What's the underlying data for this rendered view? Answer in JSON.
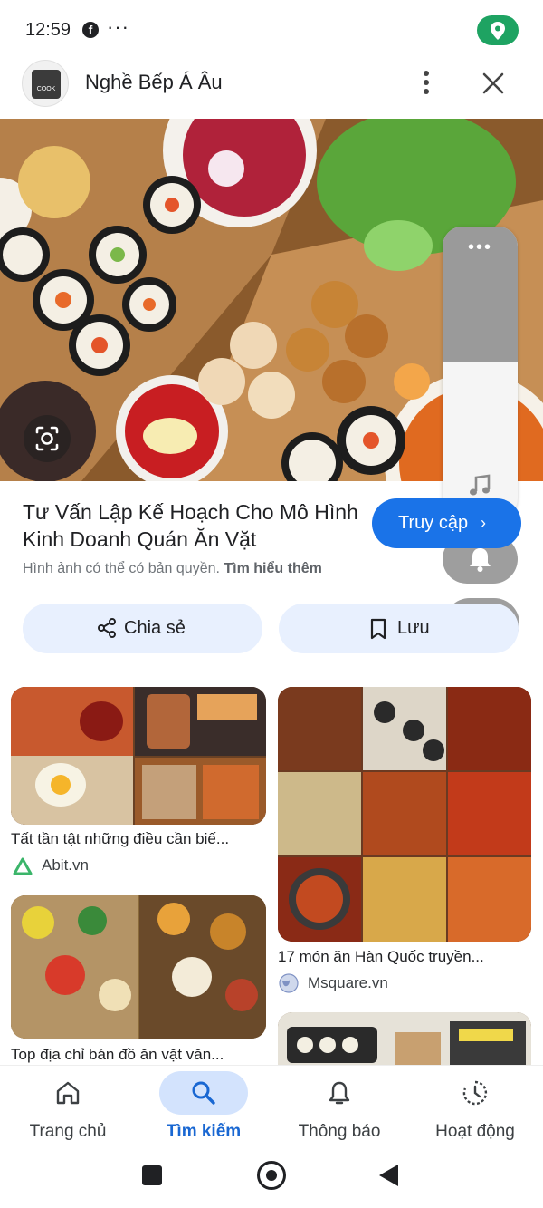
{
  "status_bar": {
    "time": "12:59",
    "notification_icon": "facebook-icon",
    "more_icon": "dots-icon",
    "location_color": "#1ea362"
  },
  "header": {
    "logo_text": "COOK",
    "title": "Nghề Bếp Á Âu"
  },
  "pin": {
    "title": "Tư Vấn Lập Kế Hoạch Cho Mô Hình Kinh Doanh Quán Ăn Vặt",
    "visit_label": "Truy cập",
    "copyright_text": "Hình ảnh có thể có bản quyền.",
    "learn_more": "Tìm hiểu thêm",
    "share_label": "Chia sẻ",
    "save_label": "Lưu"
  },
  "results": [
    {
      "title": "Tất tần tật những điều cần biế...",
      "source": "Abit.vn",
      "source_icon": "abit-logo-icon"
    },
    {
      "title": "17 món ăn Hàn Quốc truyền...",
      "source": "Msquare.vn",
      "source_icon": "globe-icon"
    },
    {
      "title": "Top địa chỉ bán đồ ăn vặt văn...",
      "source": "",
      "source_icon": ""
    },
    {
      "title": "",
      "source": "",
      "source_icon": ""
    }
  ],
  "bottom_nav": [
    {
      "label": "Trang chủ",
      "icon": "home-icon",
      "active": false
    },
    {
      "label": "Tìm kiếm",
      "icon": "search-icon",
      "active": true
    },
    {
      "label": "Thông báo",
      "icon": "bell-icon",
      "active": false
    },
    {
      "label": "Hoạt động",
      "icon": "activity-icon",
      "active": false
    }
  ],
  "colors": {
    "accent": "#1a73e8",
    "active_nav": "#1967d2",
    "nav_pill": "#d3e3fd",
    "button_bg": "#e8f0fe"
  }
}
